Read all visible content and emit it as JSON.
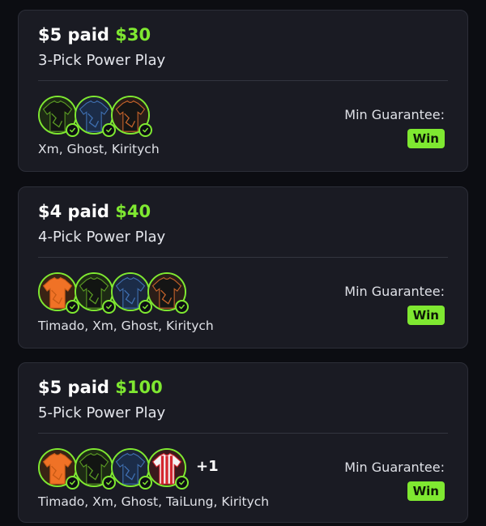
{
  "cards": [
    {
      "entry": "$5 paid",
      "payout": "$30",
      "play_type": "3-Pick Power Play",
      "players": [
        "Xm",
        "Ghost",
        "Kiritych"
      ],
      "avatars": [
        "black-green-jersey",
        "navy-blue-jersey",
        "black-orange-jersey"
      ],
      "extra_count": "",
      "player_names": "Xm, Ghost, Kiritych",
      "min_guarantee_label": "Min Guarantee:",
      "min_guarantee_value": "Win"
    },
    {
      "entry": "$4 paid",
      "payout": "$40",
      "play_type": "4-Pick Power Play",
      "players": [
        "Timado",
        "Xm",
        "Ghost",
        "Kiritych"
      ],
      "avatars": [
        "orange-jersey",
        "black-green-jersey",
        "navy-blue-jersey",
        "black-orange-jersey"
      ],
      "extra_count": "",
      "player_names": "Timado, Xm, Ghost, Kiritych",
      "min_guarantee_label": "Min Guarantee:",
      "min_guarantee_value": "Win"
    },
    {
      "entry": "$5 paid",
      "payout": "$100",
      "play_type": "5-Pick Power Play",
      "players": [
        "Timado",
        "Xm",
        "Ghost",
        "TaiLung",
        "Kiritych"
      ],
      "avatars": [
        "orange-jersey",
        "black-green-jersey",
        "navy-blue-jersey",
        "red-white-striped-jersey"
      ],
      "extra_count": "+1",
      "player_names": "Timado, Xm, Ghost, TaiLung, Kiritych",
      "min_guarantee_label": "Min Guarantee:",
      "min_guarantee_value": "Win"
    }
  ],
  "colors": {
    "accent": "#7fe831",
    "card_bg": "#1a1b23",
    "page_bg": "#0c0d12"
  }
}
